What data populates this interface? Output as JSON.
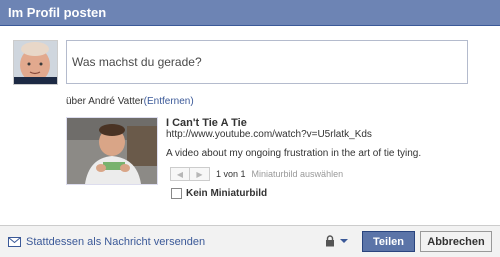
{
  "header": {
    "title": "Im Profil posten"
  },
  "composer": {
    "placeholder": "Was machst du gerade?"
  },
  "via": {
    "prefix": "über André Vatter",
    "remove_label": "(Entfernen)"
  },
  "link": {
    "title": "I Can't Tie A Tie",
    "url": "http://www.youtube.com/watch?v=U5rlatk_Kds",
    "description": "A video about my ongoing frustration in the art of tie tying."
  },
  "thumbnail_pager": {
    "count": "1 von 1",
    "hint": "Miniaturbild auswählen"
  },
  "no_thumbnail": {
    "label": "Kein Miniaturbild",
    "checked": false
  },
  "footer": {
    "message_link": "Stattdessen als Nachricht versenden",
    "share_label": "Teilen",
    "cancel_label": "Abbrechen"
  },
  "colors": {
    "header": "#6d84b4",
    "link": "#3b5998",
    "share_button": "#5b74a8"
  },
  "icons": [
    "avatar-image",
    "video-thumbnail",
    "envelope-icon",
    "lock-icon",
    "chevron-down-icon"
  ]
}
